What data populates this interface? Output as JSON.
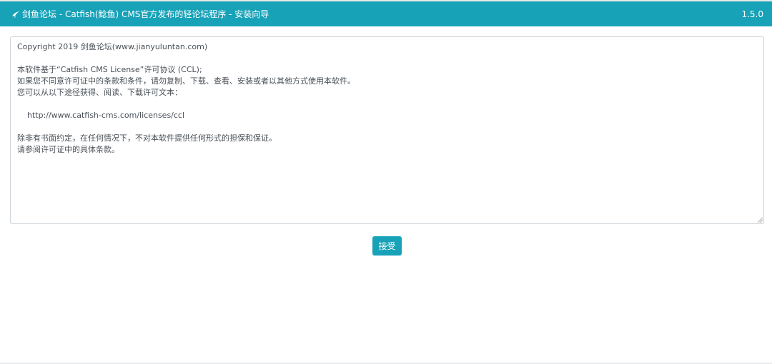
{
  "header": {
    "logo_icon": "swordfish-logo-icon",
    "title": "剑鱼论坛 - Catfish(鲶鱼) CMS官方发布的轻论坛程序 - 安装向导",
    "version": "1.5.0",
    "background_color": "#17a2b8"
  },
  "license": {
    "text": "Copyright 2019 剑鱼论坛(www.jianyuluntan.com)\n\n本软件基于“Catfish CMS License”许可协议 (CCL);\n如果您不同意许可证中的条款和条件，请勿复制、下载、查看、安装或者以其他方式使用本软件。\n您可以从以下途径获得、阅读、下载许可文本：\n\n    http://www.catfish-cms.com/licenses/ccl\n\n除非有书面约定，在任何情况下，不对本软件提供任何形式的担保和保证。\n请参阅许可证中的具体条款。"
  },
  "actions": {
    "accept_label": "接受",
    "accept_color": "#17a2b8"
  }
}
